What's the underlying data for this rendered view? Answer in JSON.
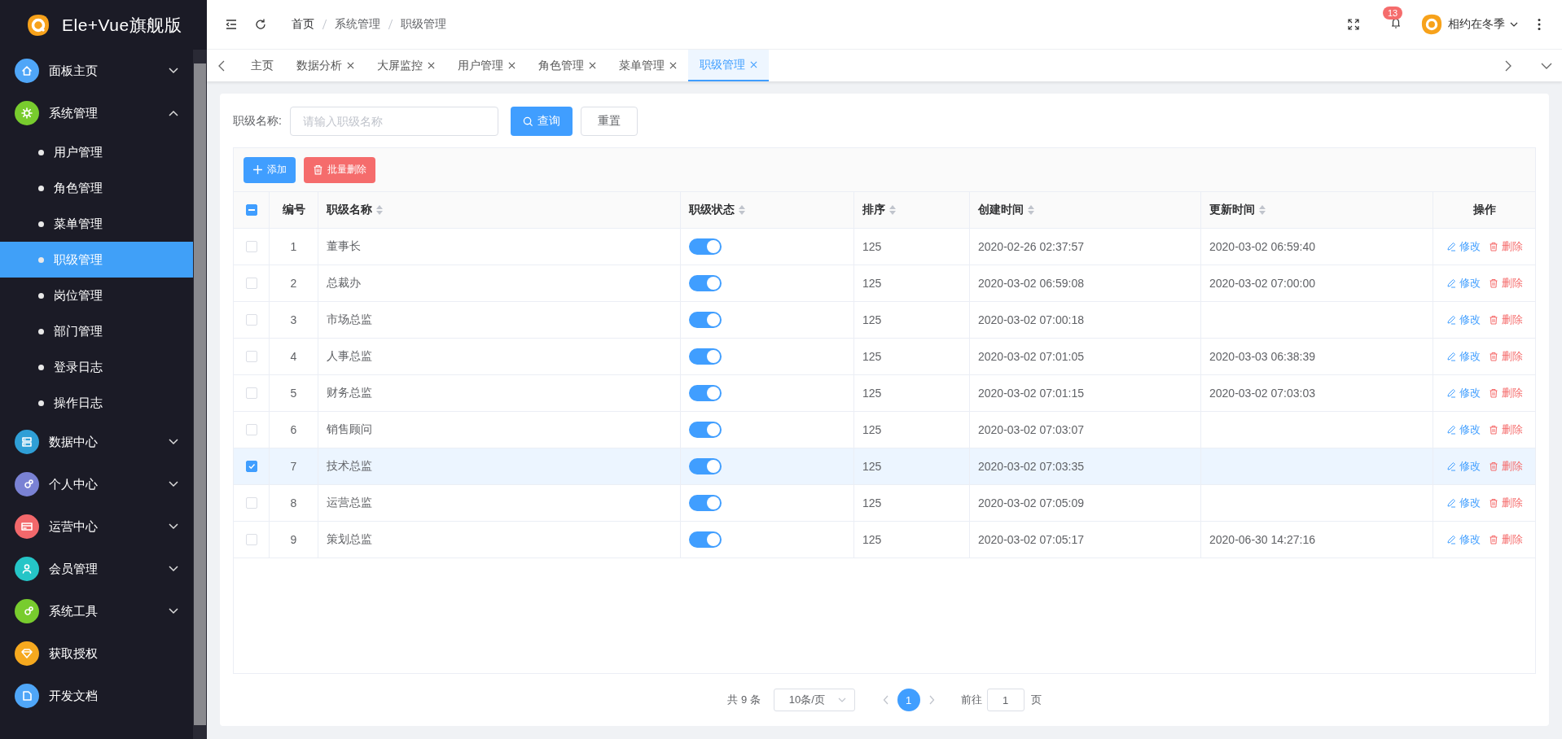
{
  "sidebar": {
    "logo_text": "Ele+Vue旗舰版",
    "items": [
      {
        "label": "面板主页",
        "color": "#4fa6f8",
        "expanded": false
      },
      {
        "label": "系统管理",
        "color": "#78cc2e",
        "expanded": true,
        "children": [
          {
            "label": "用户管理",
            "selected": false
          },
          {
            "label": "角色管理",
            "selected": false
          },
          {
            "label": "菜单管理",
            "selected": false
          },
          {
            "label": "职级管理",
            "selected": true
          },
          {
            "label": "岗位管理",
            "selected": false
          },
          {
            "label": "部门管理",
            "selected": false
          },
          {
            "label": "登录日志",
            "selected": false
          },
          {
            "label": "操作日志",
            "selected": false
          }
        ]
      },
      {
        "label": "数据中心",
        "color": "#2f9fd6",
        "expanded": false
      },
      {
        "label": "个人中心",
        "color": "#7a82d4",
        "expanded": false
      },
      {
        "label": "运营中心",
        "color": "#f2686b",
        "expanded": false
      },
      {
        "label": "会员管理",
        "color": "#25c5c7",
        "expanded": false
      },
      {
        "label": "系统工具",
        "color": "#78cc2e",
        "expanded": false
      },
      {
        "label": "获取授权",
        "color": "#f6a91f"
      },
      {
        "label": "开发文档",
        "color": "#4fa6f8"
      }
    ]
  },
  "header": {
    "breadcrumb": [
      "首页",
      "系统管理",
      "职级管理"
    ],
    "notification_count": "13",
    "user": "相约在冬季"
  },
  "tabs": [
    {
      "label": "主页",
      "closable": false,
      "selected": false
    },
    {
      "label": "数据分析",
      "closable": true,
      "selected": false
    },
    {
      "label": "大屏监控",
      "closable": true,
      "selected": false
    },
    {
      "label": "用户管理",
      "closable": true,
      "selected": false
    },
    {
      "label": "角色管理",
      "closable": true,
      "selected": false
    },
    {
      "label": "菜单管理",
      "closable": true,
      "selected": false
    },
    {
      "label": "职级管理",
      "closable": true,
      "selected": true
    }
  ],
  "search": {
    "label": "职级名称:",
    "placeholder": "请输入职级名称",
    "search_button": "查询",
    "reset_button": "重置"
  },
  "toolbar": {
    "add_button": "添加",
    "batch_delete_button": "批量删除"
  },
  "table": {
    "select_all": {
      "indeterminate": true
    },
    "columns": [
      {
        "label": "编号",
        "sortable": false
      },
      {
        "label": "职级名称",
        "sortable": true
      },
      {
        "label": "职级状态",
        "sortable": true
      },
      {
        "label": "排序",
        "sortable": true
      },
      {
        "label": "创建时间",
        "sortable": true
      },
      {
        "label": "更新时间",
        "sortable": true
      },
      {
        "label": "操作",
        "sortable": false
      }
    ],
    "rows": [
      {
        "checked": false,
        "id": "1",
        "name": "董事长",
        "enabled": true,
        "sort": "125",
        "created": "2020-02-26 02:37:57",
        "updated": "2020-03-02 06:59:40",
        "edit": "修改",
        "delete": "删除"
      },
      {
        "checked": false,
        "id": "2",
        "name": "总裁办",
        "enabled": true,
        "sort": "125",
        "created": "2020-03-02 06:59:08",
        "updated": "2020-03-02 07:00:00",
        "edit": "修改",
        "delete": "删除"
      },
      {
        "checked": false,
        "id": "3",
        "name": "市场总监",
        "enabled": true,
        "sort": "125",
        "created": "2020-03-02 07:00:18",
        "edit": "修改",
        "delete": "删除"
      },
      {
        "checked": false,
        "id": "4",
        "name": "人事总监",
        "enabled": true,
        "sort": "125",
        "created": "2020-03-02 07:01:05",
        "updated": "2020-03-03 06:38:39",
        "edit": "修改",
        "delete": "删除"
      },
      {
        "checked": false,
        "id": "5",
        "name": "财务总监",
        "enabled": true,
        "sort": "125",
        "created": "2020-03-02 07:01:15",
        "updated": "2020-03-02 07:03:03",
        "edit": "修改",
        "delete": "删除"
      },
      {
        "checked": false,
        "id": "6",
        "name": "销售顾问",
        "enabled": true,
        "sort": "125",
        "created": "2020-03-02 07:03:07",
        "edit": "修改",
        "delete": "删除"
      },
      {
        "checked": true,
        "id": "7",
        "name": "技术总监",
        "enabled": true,
        "sort": "125",
        "created": "2020-03-02 07:03:35",
        "edit": "修改",
        "delete": "删除"
      },
      {
        "checked": false,
        "id": "8",
        "name": "运营总监",
        "enabled": true,
        "sort": "125",
        "created": "2020-03-02 07:05:09",
        "edit": "修改",
        "delete": "删除"
      },
      {
        "checked": false,
        "id": "9",
        "name": "策划总监",
        "enabled": true,
        "sort": "125",
        "created": "2020-03-02 07:05:17",
        "updated": "2020-06-30 14:27:16",
        "edit": "修改",
        "delete": "删除"
      }
    ]
  },
  "pagination": {
    "total": "共 9 条",
    "page_size": "10条/页",
    "pages": [
      {
        "label": "1",
        "selected": true
      }
    ],
    "goto_label": "前往",
    "goto_value": "1",
    "goto_suffix": "页"
  }
}
